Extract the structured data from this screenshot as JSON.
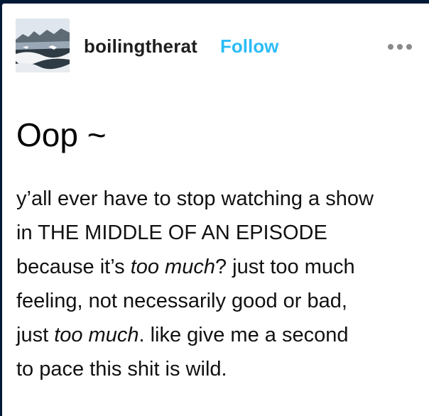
{
  "post": {
    "author": {
      "username": "boilingtherat",
      "avatar_icon": "snowy-landscape-avatar"
    },
    "follow_label": "Follow",
    "more_icon": "ellipsis-icon",
    "title": "Oop ~",
    "body": {
      "line1": "y’all ever have to stop watching a show",
      "line2": "in THE MIDDLE OF AN EPISODE",
      "line3_a": "because it’s ",
      "line3_em": "too much",
      "line3_b": "? just too much",
      "line4": "feeling, not necessarily good or bad,",
      "line5_a": "just ",
      "line5_em": "too much",
      "line5_b": ". like give me a second",
      "line6": "to pace this shit is wild."
    }
  },
  "colors": {
    "page_background": "#001935",
    "card_background": "#ffffff",
    "follow_accent": "#2bbcf6",
    "text": "#111111",
    "icon_gray": "#8a8a8a"
  }
}
